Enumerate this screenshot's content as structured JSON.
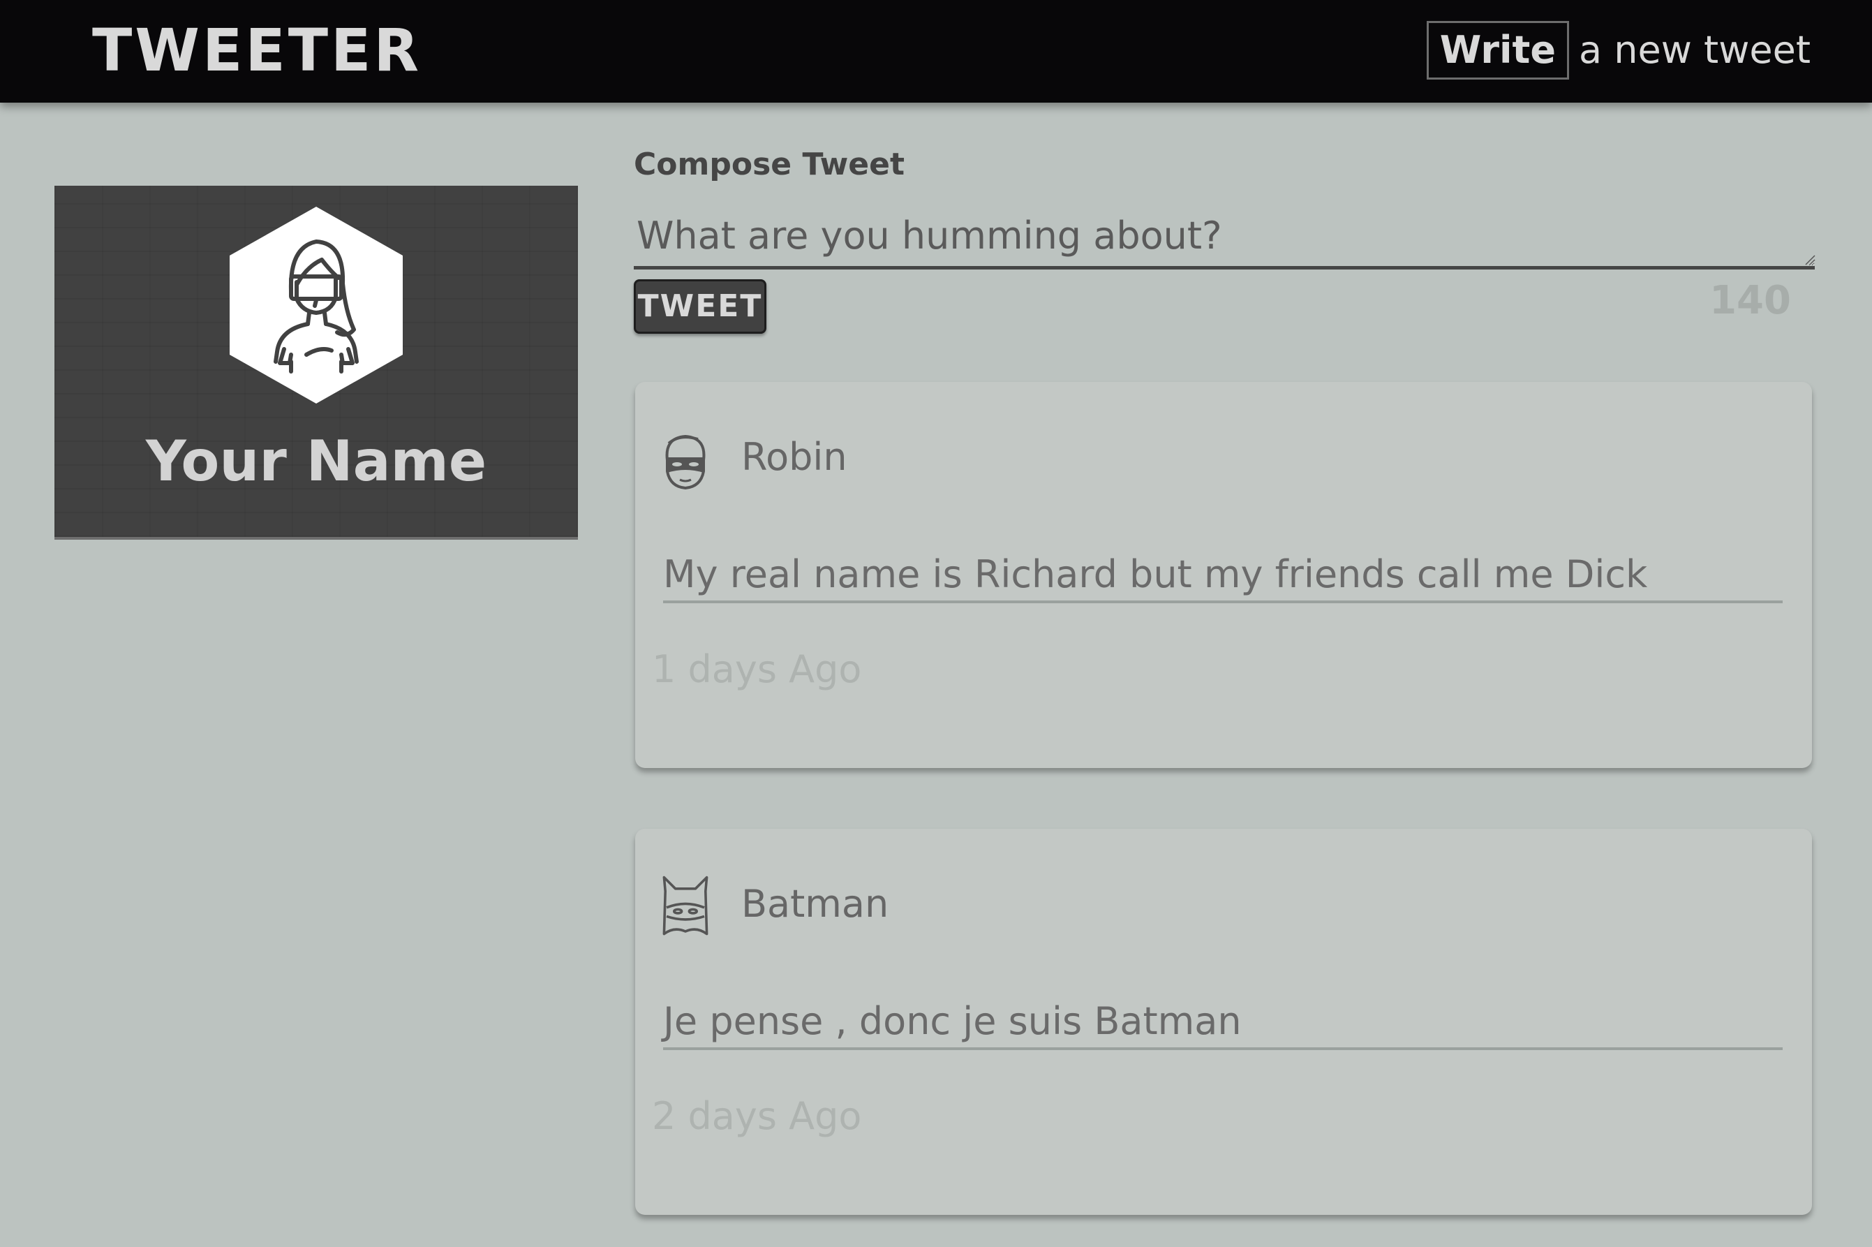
{
  "header": {
    "brand": "TWEETER",
    "write_label": "Write",
    "write_rest": "a new tweet"
  },
  "profile": {
    "name": "Your Name",
    "avatar_icon": "woman-avatar-icon"
  },
  "compose": {
    "label": "Compose Tweet",
    "placeholder": "What are you humming about?",
    "button_label": "TWEET",
    "counter": "140"
  },
  "tweets": [
    {
      "author": "Robin",
      "icon": "robin-mask-icon",
      "text": "My real name is Richard but my friends call me Dick",
      "time": "1 days Ago"
    },
    {
      "author": "Batman",
      "icon": "batman-mask-icon",
      "text": "Je pense , donc je suis Batman",
      "time": "2 days Ago"
    }
  ],
  "colors": {
    "background": "#bcc3c0",
    "topbar": "#080709",
    "card_dark": "#414141",
    "tweet_card": "#c3c8c5"
  }
}
